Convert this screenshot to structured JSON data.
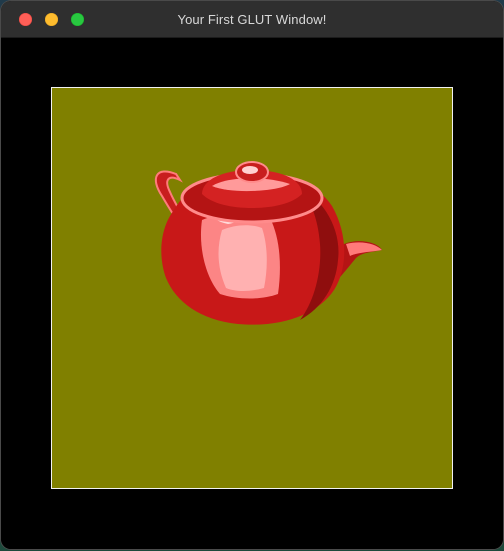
{
  "window": {
    "title": "Your First GLUT Window!",
    "controls": {
      "close_icon": "close-icon",
      "minimize_icon": "minimize-icon",
      "zoom_icon": "zoom-icon"
    }
  },
  "scene": {
    "background_color": "#808000",
    "viewport_border_color": "#ffffff",
    "object": "teapot",
    "object_color": "#e02a2a"
  }
}
